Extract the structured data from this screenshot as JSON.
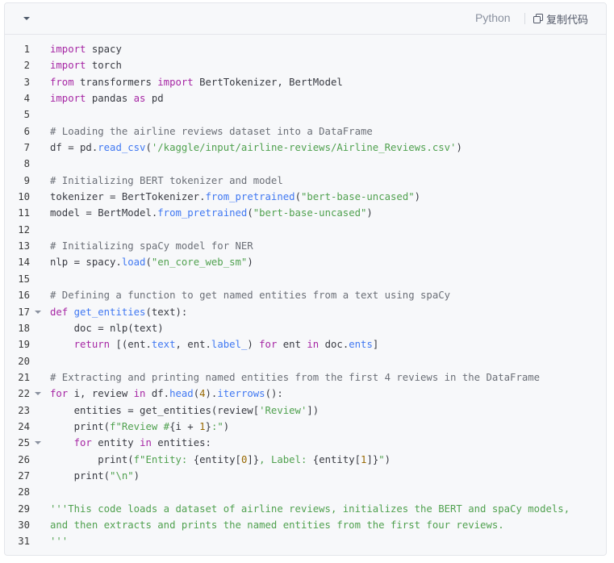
{
  "toolbar": {
    "language": "Python",
    "copy_label": "复制代码",
    "collapse_icon": "chevron-down-icon",
    "copy_icon": "copy-icon"
  },
  "colors": {
    "keyword": "#a626a4",
    "comment": "#6b6f77",
    "string": "#50a14f",
    "function": "#4078f2",
    "number": "#986801",
    "plain": "#383a42"
  },
  "code_lines": [
    {
      "n": "1",
      "fold": false,
      "tokens": [
        [
          "kw",
          "import"
        ],
        [
          "pl",
          " spacy"
        ]
      ]
    },
    {
      "n": "2",
      "fold": false,
      "tokens": [
        [
          "kw",
          "import"
        ],
        [
          "pl",
          " torch"
        ]
      ]
    },
    {
      "n": "3",
      "fold": false,
      "tokens": [
        [
          "kw",
          "from"
        ],
        [
          "pl",
          " transformers "
        ],
        [
          "kw",
          "import"
        ],
        [
          "pl",
          " BertTokenizer, BertModel"
        ]
      ]
    },
    {
      "n": "4",
      "fold": false,
      "tokens": [
        [
          "kw",
          "import"
        ],
        [
          "pl",
          " pandas "
        ],
        [
          "kw",
          "as"
        ],
        [
          "pl",
          " pd"
        ]
      ]
    },
    {
      "n": "5",
      "fold": false,
      "tokens": []
    },
    {
      "n": "6",
      "fold": false,
      "tokens": [
        [
          "cm",
          "# Loading the airline reviews dataset into a DataFrame"
        ]
      ]
    },
    {
      "n": "7",
      "fold": false,
      "tokens": [
        [
          "pl",
          "df = pd."
        ],
        [
          "fn",
          "read_csv"
        ],
        [
          "pl",
          "("
        ],
        [
          "str",
          "'/kaggle/input/airline-reviews/Airline_Reviews.csv'"
        ],
        [
          "pl",
          ")"
        ]
      ]
    },
    {
      "n": "8",
      "fold": false,
      "tokens": []
    },
    {
      "n": "9",
      "fold": false,
      "tokens": [
        [
          "cm",
          "# Initializing BERT tokenizer and model"
        ]
      ]
    },
    {
      "n": "10",
      "fold": false,
      "tokens": [
        [
          "pl",
          "tokenizer = BertTokenizer."
        ],
        [
          "fn",
          "from_pretrained"
        ],
        [
          "pl",
          "("
        ],
        [
          "str",
          "\"bert-base-uncased\""
        ],
        [
          "pl",
          ")"
        ]
      ]
    },
    {
      "n": "11",
      "fold": false,
      "tokens": [
        [
          "pl",
          "model = BertModel."
        ],
        [
          "fn",
          "from_pretrained"
        ],
        [
          "pl",
          "("
        ],
        [
          "str",
          "\"bert-base-uncased\""
        ],
        [
          "pl",
          ")"
        ]
      ]
    },
    {
      "n": "12",
      "fold": false,
      "tokens": []
    },
    {
      "n": "13",
      "fold": false,
      "tokens": [
        [
          "cm",
          "# Initializing spaCy model for NER"
        ]
      ]
    },
    {
      "n": "14",
      "fold": false,
      "tokens": [
        [
          "pl",
          "nlp = spacy."
        ],
        [
          "fn",
          "load"
        ],
        [
          "pl",
          "("
        ],
        [
          "str",
          "\"en_core_web_sm\""
        ],
        [
          "pl",
          ")"
        ]
      ]
    },
    {
      "n": "15",
      "fold": false,
      "tokens": []
    },
    {
      "n": "16",
      "fold": false,
      "tokens": [
        [
          "cm",
          "# Defining a function to get named entities from a text using spaCy"
        ]
      ]
    },
    {
      "n": "17",
      "fold": true,
      "tokens": [
        [
          "kw",
          "def"
        ],
        [
          "pl",
          " "
        ],
        [
          "fn",
          "get_entities"
        ],
        [
          "pl",
          "(text):"
        ]
      ]
    },
    {
      "n": "18",
      "fold": false,
      "tokens": [
        [
          "pl",
          "    doc = nlp(text)"
        ]
      ]
    },
    {
      "n": "19",
      "fold": false,
      "tokens": [
        [
          "pl",
          "    "
        ],
        [
          "kw",
          "return"
        ],
        [
          "pl",
          " [(ent."
        ],
        [
          "fn",
          "text"
        ],
        [
          "pl",
          ", ent."
        ],
        [
          "fn",
          "label_"
        ],
        [
          "pl",
          ") "
        ],
        [
          "kw",
          "for"
        ],
        [
          "pl",
          " ent "
        ],
        [
          "kw",
          "in"
        ],
        [
          "pl",
          " doc."
        ],
        [
          "fn",
          "ents"
        ],
        [
          "pl",
          "]"
        ]
      ]
    },
    {
      "n": "20",
      "fold": false,
      "tokens": []
    },
    {
      "n": "21",
      "fold": false,
      "tokens": [
        [
          "cm",
          "# Extracting and printing named entities from the first 4 reviews in the DataFrame"
        ]
      ]
    },
    {
      "n": "22",
      "fold": true,
      "tokens": [
        [
          "kw",
          "for"
        ],
        [
          "pl",
          " i, review "
        ],
        [
          "kw",
          "in"
        ],
        [
          "pl",
          " df."
        ],
        [
          "fn",
          "head"
        ],
        [
          "pl",
          "("
        ],
        [
          "num",
          "4"
        ],
        [
          "pl",
          ")."
        ],
        [
          "fn",
          "iterrows"
        ],
        [
          "pl",
          "():"
        ]
      ]
    },
    {
      "n": "23",
      "fold": false,
      "tokens": [
        [
          "pl",
          "    entities = get_entities(review["
        ],
        [
          "str",
          "'Review'"
        ],
        [
          "pl",
          "])"
        ]
      ]
    },
    {
      "n": "24",
      "fold": false,
      "tokens": [
        [
          "pl",
          "    print("
        ],
        [
          "str",
          "f\"Review #"
        ],
        [
          "pl",
          "{i + "
        ],
        [
          "num",
          "1"
        ],
        [
          "pl",
          "}"
        ],
        [
          "str",
          ":\""
        ],
        [
          "pl",
          ")"
        ]
      ]
    },
    {
      "n": "25",
      "fold": true,
      "tokens": [
        [
          "pl",
          "    "
        ],
        [
          "kw",
          "for"
        ],
        [
          "pl",
          " entity "
        ],
        [
          "kw",
          "in"
        ],
        [
          "pl",
          " entities:"
        ]
      ]
    },
    {
      "n": "26",
      "fold": false,
      "tokens": [
        [
          "pl",
          "        print("
        ],
        [
          "str",
          "f\"Entity: "
        ],
        [
          "pl",
          "{entity["
        ],
        [
          "num",
          "0"
        ],
        [
          "pl",
          "]}"
        ],
        [
          "str",
          ", Label: "
        ],
        [
          "pl",
          "{entity["
        ],
        [
          "num",
          "1"
        ],
        [
          "pl",
          "]}"
        ],
        [
          "str",
          "\""
        ],
        [
          "pl",
          ")"
        ]
      ]
    },
    {
      "n": "27",
      "fold": false,
      "tokens": [
        [
          "pl",
          "    print("
        ],
        [
          "str",
          "\"\\n\""
        ],
        [
          "pl",
          ")"
        ]
      ]
    },
    {
      "n": "28",
      "fold": false,
      "tokens": []
    },
    {
      "n": "29",
      "fold": false,
      "tokens": [
        [
          "str",
          "'''This code loads a dataset of airline reviews, initializes the BERT and spaCy models,"
        ]
      ]
    },
    {
      "n": "30",
      "fold": false,
      "tokens": [
        [
          "str",
          "and then extracts and prints the named entities from the first four reviews."
        ]
      ]
    },
    {
      "n": "31",
      "fold": false,
      "tokens": [
        [
          "str",
          "'''"
        ]
      ]
    }
  ]
}
